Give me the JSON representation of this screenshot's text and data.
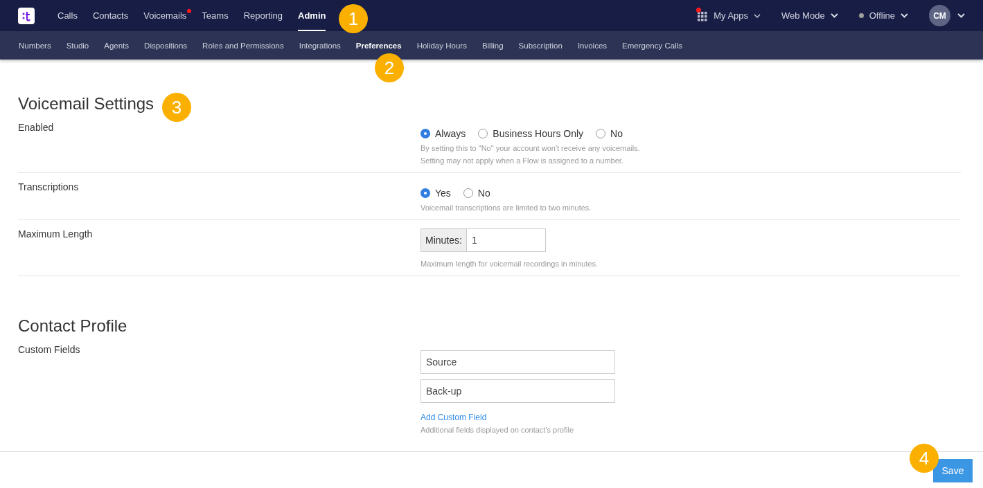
{
  "top_nav": {
    "items": [
      {
        "label": "Calls",
        "selected": false,
        "notification": false
      },
      {
        "label": "Contacts",
        "selected": false,
        "notification": false
      },
      {
        "label": "Voicemails",
        "selected": false,
        "notification": true
      },
      {
        "label": "Teams",
        "selected": false,
        "notification": false
      },
      {
        "label": "Reporting",
        "selected": false,
        "notification": false
      },
      {
        "label": "Admin",
        "selected": true,
        "notification": false
      }
    ],
    "my_apps": {
      "label": "My Apps",
      "notification": true
    },
    "mode": {
      "label": "Web Mode"
    },
    "status": {
      "label": "Offline",
      "color": "#9e9e9e"
    },
    "avatar": {
      "initials": "CM"
    }
  },
  "sub_nav": {
    "items": [
      {
        "label": "Numbers",
        "selected": false
      },
      {
        "label": "Studio",
        "selected": false
      },
      {
        "label": "Agents",
        "selected": false
      },
      {
        "label": "Dispositions",
        "selected": false
      },
      {
        "label": "Roles and Permissions",
        "selected": false
      },
      {
        "label": "Integrations",
        "selected": false
      },
      {
        "label": "Preferences",
        "selected": true
      },
      {
        "label": "Holiday Hours",
        "selected": false
      },
      {
        "label": "Billing",
        "selected": false
      },
      {
        "label": "Subscription",
        "selected": false
      },
      {
        "label": "Invoices",
        "selected": false
      },
      {
        "label": "Emergency Calls",
        "selected": false
      }
    ]
  },
  "sections": [
    {
      "title": "Voicemail Settings",
      "settings": [
        {
          "kind": "radio",
          "label": "Enabled",
          "options": [
            {
              "label": "Always",
              "selected": true
            },
            {
              "label": "Business Hours Only",
              "selected": false
            },
            {
              "label": "No",
              "selected": false
            }
          ],
          "help": [
            "By setting this to \"No\" your account won't receive any voicemails.",
            "Setting may not apply when a Flow is assigned to a number."
          ]
        },
        {
          "kind": "radio",
          "label": "Transcriptions",
          "options": [
            {
              "label": "Yes",
              "selected": true
            },
            {
              "label": "No",
              "selected": false
            }
          ],
          "help": [
            "Voicemail transcriptions are limited to two minutes."
          ]
        },
        {
          "kind": "number",
          "label": "Maximum Length",
          "addon": "Minutes:",
          "value": "1",
          "help": [
            "Maximum length for voicemail recordings in minutes."
          ]
        }
      ]
    },
    {
      "title": "Contact Profile",
      "settings": [
        {
          "kind": "fields",
          "label": "Custom Fields",
          "values": [
            "Source",
            "Back-up"
          ],
          "link": "Add Custom Field",
          "help": [
            "Additional fields displayed on contact's profile"
          ]
        }
      ]
    }
  ],
  "footer": {
    "save": "Save"
  },
  "callouts": [
    "1",
    "2",
    "3",
    "4"
  ]
}
